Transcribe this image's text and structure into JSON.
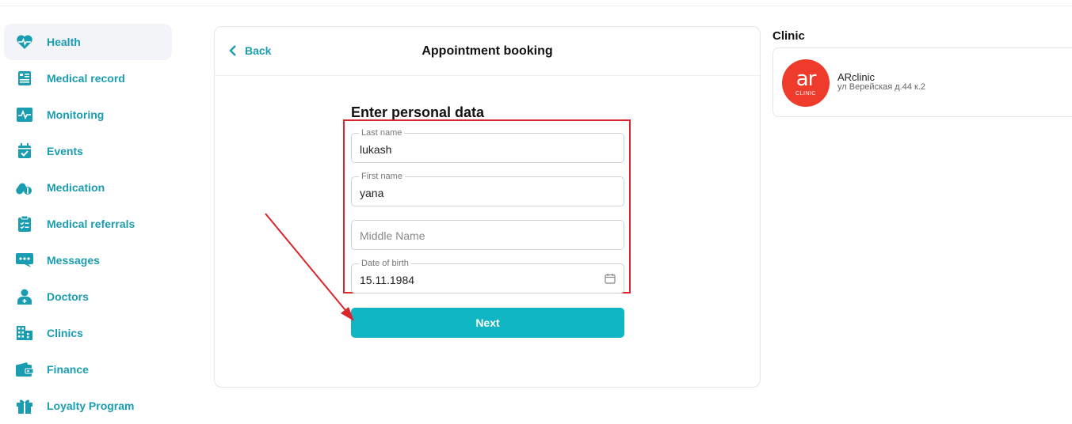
{
  "sidebar": {
    "items": [
      {
        "label": "Health",
        "icon": "heart-pulse-icon"
      },
      {
        "label": "Medical record",
        "icon": "medical-record-icon"
      },
      {
        "label": "Monitoring",
        "icon": "monitoring-icon"
      },
      {
        "label": "Events",
        "icon": "calendar-check-icon"
      },
      {
        "label": "Medication",
        "icon": "pills-icon"
      },
      {
        "label": "Medical referrals",
        "icon": "clipboard-icon"
      },
      {
        "label": "Messages",
        "icon": "chat-icon"
      },
      {
        "label": "Doctors",
        "icon": "doctor-icon"
      },
      {
        "label": "Clinics",
        "icon": "building-icon"
      },
      {
        "label": "Finance",
        "icon": "wallet-icon"
      },
      {
        "label": "Loyalty Program",
        "icon": "gift-icon"
      }
    ],
    "active": "Health"
  },
  "booking": {
    "back_label": "Back",
    "title": "Appointment booking",
    "form_heading": "Enter personal data",
    "last_name_label": "Last name",
    "last_name_value": "lukash",
    "first_name_label": "First name",
    "first_name_value": "yana",
    "middle_name_placeholder": "Middle Name",
    "dob_label": "Date of birth",
    "dob_value": "15.11.1984",
    "next_label": "Next"
  },
  "clinic": {
    "heading": "Clinic",
    "logo_text": "ar",
    "logo_subtext": "CLINIC",
    "name": "ARclinic",
    "address": "ул Верейская д.44 к.2"
  },
  "colors": {
    "accent": "#1a9db0",
    "button": "#10b6c4",
    "highlight": "#d9252b",
    "logo": "#ee3b2b"
  }
}
